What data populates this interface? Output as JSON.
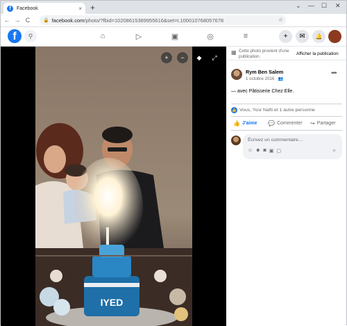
{
  "browser": {
    "tab_title": "Facebook",
    "tab_close": "×",
    "new_tab": "+",
    "url_main": "facebook.com",
    "url_rest": "/photo/?fbid=10208615389955616&set=t.100010768057678",
    "nav": {
      "back": "←",
      "forward": "→",
      "reload": "C"
    },
    "win_chevron": "⌄",
    "win_min": "—",
    "win_max": "☐",
    "win_close": "✕"
  },
  "fb": {
    "logo": "f",
    "search_icon": "⚲",
    "nav_home": "⌂",
    "nav_watch": "▷",
    "nav_market": "▣",
    "nav_groups": "◎",
    "nav_menu": "≡",
    "create": "+",
    "messenger": "✉",
    "notifications": "🔔"
  },
  "photo_controls": {
    "zoom_in": "+",
    "zoom_out": "−",
    "tag": "◆",
    "fullscreen": "⤢"
  },
  "panel": {
    "notice_text": "Cette photo provient d'une publication.",
    "notice_link": "Afficher la publication",
    "author_name": "Rym Ben Salem",
    "author_date": "1 octobre 2016 · 👥",
    "more": "•••",
    "caption_prefix": "— avec ",
    "caption_page": "Pâtisserie Chez Elle",
    "caption_suffix": ".",
    "reactions_text": "Vous, Yosr Nafti et 1 autre personne",
    "like_label": "J'aime",
    "comment_label": "Commenter",
    "share_label": "Partager",
    "comment_placeholder": "Écrivez un commentaire…",
    "send": "➤"
  },
  "colors": {
    "fb_blue": "#1877f2",
    "viewer_bg": "#000000"
  }
}
